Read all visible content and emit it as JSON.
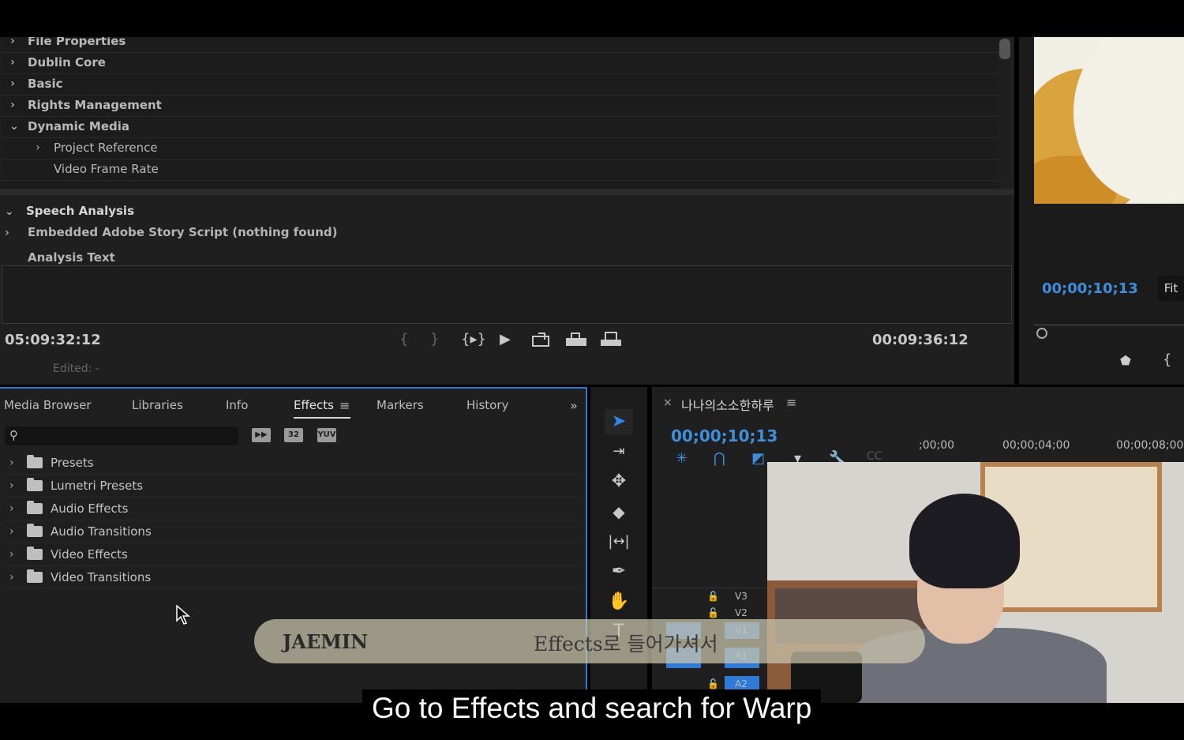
{
  "metadata_panel": {
    "rows": [
      {
        "label": "File Properties",
        "expanded": false,
        "indent": 0
      },
      {
        "label": "Dublin Core",
        "expanded": false,
        "indent": 0
      },
      {
        "label": "Basic",
        "expanded": false,
        "indent": 0
      },
      {
        "label": "Rights Management",
        "expanded": false,
        "indent": 0
      },
      {
        "label": "Dynamic Media",
        "expanded": true,
        "indent": 0
      },
      {
        "label": "Project Reference",
        "expanded": false,
        "indent": 1
      },
      {
        "label": "Video Frame Rate",
        "expanded": null,
        "indent": 1
      }
    ],
    "speech_analysis": "Speech Analysis",
    "embedded_script": "Embedded Adobe Story Script (nothing found)",
    "analysis_text": "Analysis Text",
    "timecode_in": "05:09:32:12",
    "timecode_out": "00:09:36:12",
    "edited": "Edited: -"
  },
  "program_monitor": {
    "timecode": "00;00;10;13",
    "zoom": "Fit"
  },
  "effects_panel": {
    "tabs": [
      {
        "label": "Media Browser",
        "active": false
      },
      {
        "label": "Libraries",
        "active": false
      },
      {
        "label": "Info",
        "active": false
      },
      {
        "label": "Effects",
        "active": true
      },
      {
        "label": "Markers",
        "active": false
      },
      {
        "label": "History",
        "active": false
      }
    ],
    "search_value": "",
    "filter_icons": [
      "32",
      "YUV"
    ],
    "tree": [
      "Presets",
      "Lumetri Presets",
      "Audio Effects",
      "Audio Transitions",
      "Video Effects",
      "Video Transitions"
    ]
  },
  "timeline": {
    "sequence_name": "나나의소소한하루",
    "timecode": "00;00;10;13",
    "ruler": [
      ";00;00",
      "00;00;04;00",
      "00;00;08;00"
    ],
    "tracks": [
      "V3",
      "V2",
      "V1",
      "A1",
      "A2"
    ]
  },
  "overlay": {
    "logo": "JAEMIN",
    "caption": "Effects로 들어가셔서"
  },
  "subtitle": "Go to Effects and search for Warp",
  "colors": {
    "accent_blue": "#3d8fdd",
    "panel_bg": "#1f1f1f"
  }
}
